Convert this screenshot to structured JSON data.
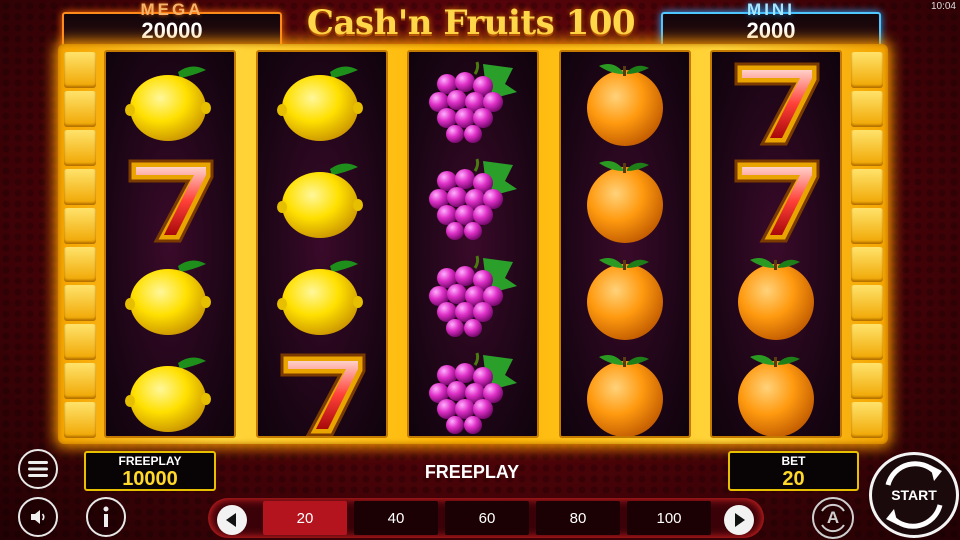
{
  "status_bar": {
    "time": "10:04"
  },
  "game": {
    "title": "Cash'n Fruits 100"
  },
  "jackpots": {
    "mega": {
      "label": "MEGA",
      "value": "20000"
    },
    "mini": {
      "label": "MINI",
      "value": "2000"
    }
  },
  "reels": [
    [
      "lemon",
      "seven",
      "lemon",
      "lemon"
    ],
    [
      "lemon",
      "lemon",
      "lemon",
      "seven"
    ],
    [
      "grapes",
      "grapes",
      "grapes",
      "grapes"
    ],
    [
      "orange",
      "orange",
      "orange",
      "orange"
    ],
    [
      "seven",
      "seven",
      "orange",
      "orange"
    ]
  ],
  "panel": {
    "freeplay_label": "FREEPLAY",
    "freeplay_value": "10000",
    "center_label": "FREEPLAY",
    "bet_label": "BET",
    "bet_value": "20",
    "start_label": "START",
    "auto_label": "A"
  },
  "bet_options": [
    "20",
    "40",
    "60",
    "80",
    "100"
  ],
  "selected_bet_index": 0,
  "icons": [
    "menu-icon",
    "sound-icon",
    "info-icon",
    "arrow-left-icon",
    "arrow-right-icon",
    "autoplay-icon",
    "start-spin-icon"
  ],
  "colors": {
    "mega_border": "#ff8a1c",
    "mini_border": "#4fc6ff",
    "frame_gold": "#ffd53b",
    "selected_bet": "#b4141e",
    "value_yellow": "#ffd82a"
  }
}
